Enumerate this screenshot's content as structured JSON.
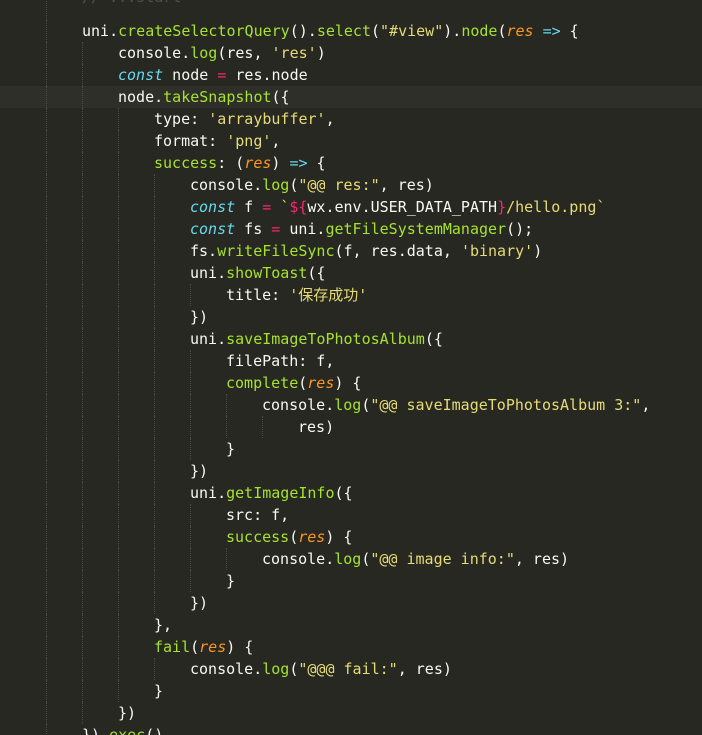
{
  "editor": {
    "colors": {
      "background": "#272822",
      "current_line": "#2e2f29",
      "indent_guide": "#4a4b45",
      "plain": "#f8f8f2",
      "keyword": "#66d9ef",
      "function": "#a6e22e",
      "string": "#e6db74",
      "parameter": "#fd971f",
      "operator": "#f92672",
      "comment": "#75715e"
    },
    "current_line_index": 4,
    "lines": [
      {
        "indent": 2,
        "tokens": [
          [
            "c",
            "// ...start"
          ]
        ]
      },
      {
        "indent": 2,
        "tokens": [
          [
            "p",
            "uni."
          ],
          [
            "f",
            "createSelectorQuery"
          ],
          [
            "p",
            "()."
          ],
          [
            "f",
            "select"
          ],
          [
            "p",
            "("
          ],
          [
            "s",
            "\"#view\""
          ],
          [
            "p",
            ")."
          ],
          [
            "f",
            "node"
          ],
          [
            "p",
            "("
          ],
          [
            "a",
            "res"
          ],
          [
            "p",
            " "
          ],
          [
            "k",
            "=>"
          ],
          [
            "p",
            " {"
          ]
        ]
      },
      {
        "indent": 3,
        "tokens": [
          [
            "p",
            "console."
          ],
          [
            "f",
            "log"
          ],
          [
            "p",
            "(res, "
          ],
          [
            "s",
            "'res'"
          ],
          [
            "p",
            ")"
          ]
        ]
      },
      {
        "indent": 3,
        "tokens": [
          [
            "k",
            "const"
          ],
          [
            "p",
            " node "
          ],
          [
            "o",
            "="
          ],
          [
            "p",
            " res.node"
          ]
        ]
      },
      {
        "indent": 3,
        "tokens": [
          [
            "p",
            "node."
          ],
          [
            "f",
            "takeSnapshot"
          ],
          [
            "p",
            "({"
          ]
        ]
      },
      {
        "indent": 4,
        "tokens": [
          [
            "p",
            "type: "
          ],
          [
            "s",
            "'arraybuffer'"
          ],
          [
            "p",
            ","
          ]
        ]
      },
      {
        "indent": 4,
        "tokens": [
          [
            "p",
            "format: "
          ],
          [
            "s",
            "'png'"
          ],
          [
            "p",
            ","
          ]
        ]
      },
      {
        "indent": 4,
        "tokens": [
          [
            "f",
            "success"
          ],
          [
            "p",
            ": ("
          ],
          [
            "a",
            "res"
          ],
          [
            "p",
            ") "
          ],
          [
            "k",
            "=>"
          ],
          [
            "p",
            " {"
          ]
        ]
      },
      {
        "indent": 5,
        "tokens": [
          [
            "p",
            "console."
          ],
          [
            "f",
            "log"
          ],
          [
            "p",
            "("
          ],
          [
            "s",
            "\"@@ res:\""
          ],
          [
            "p",
            ", res)"
          ]
        ]
      },
      {
        "indent": 5,
        "tokens": [
          [
            "k",
            "const"
          ],
          [
            "p",
            " f "
          ],
          [
            "o",
            "="
          ],
          [
            "p",
            " "
          ],
          [
            "s",
            "`"
          ],
          [
            "o",
            "${"
          ],
          [
            "p",
            "wx.env.USER_DATA_PATH"
          ],
          [
            "o",
            "}"
          ],
          [
            "s",
            "/hello.png`"
          ]
        ]
      },
      {
        "indent": 5,
        "tokens": [
          [
            "k",
            "const"
          ],
          [
            "p",
            " fs "
          ],
          [
            "o",
            "="
          ],
          [
            "p",
            " uni."
          ],
          [
            "f",
            "getFileSystemManager"
          ],
          [
            "p",
            "();"
          ]
        ]
      },
      {
        "indent": 5,
        "tokens": [
          [
            "p",
            "fs."
          ],
          [
            "f",
            "writeFileSync"
          ],
          [
            "p",
            "(f, res.data, "
          ],
          [
            "s",
            "'binary'"
          ],
          [
            "p",
            ")"
          ]
        ]
      },
      {
        "indent": 5,
        "tokens": [
          [
            "p",
            "uni."
          ],
          [
            "f",
            "showToast"
          ],
          [
            "p",
            "({"
          ]
        ]
      },
      {
        "indent": 6,
        "tokens": [
          [
            "p",
            "title: "
          ],
          [
            "s",
            "'保存成功'"
          ]
        ]
      },
      {
        "indent": 5,
        "tokens": [
          [
            "p",
            "})"
          ]
        ]
      },
      {
        "indent": 5,
        "tokens": [
          [
            "p",
            "uni."
          ],
          [
            "f",
            "saveImageToPhotosAlbum"
          ],
          [
            "p",
            "({"
          ]
        ]
      },
      {
        "indent": 6,
        "tokens": [
          [
            "p",
            "filePath: f,"
          ]
        ]
      },
      {
        "indent": 6,
        "tokens": [
          [
            "f",
            "complete"
          ],
          [
            "p",
            "("
          ],
          [
            "a",
            "res"
          ],
          [
            "p",
            ") {"
          ]
        ]
      },
      {
        "indent": 7,
        "tokens": [
          [
            "p",
            "console."
          ],
          [
            "f",
            "log"
          ],
          [
            "p",
            "("
          ],
          [
            "s",
            "\"@@ saveImageToPhotosAlbum 3:\""
          ],
          [
            "p",
            ","
          ]
        ]
      },
      {
        "indent": 8,
        "tokens": [
          [
            "p",
            "res)"
          ]
        ]
      },
      {
        "indent": 6,
        "tokens": [
          [
            "p",
            "}"
          ]
        ]
      },
      {
        "indent": 5,
        "tokens": [
          [
            "p",
            "})"
          ]
        ]
      },
      {
        "indent": 5,
        "tokens": [
          [
            "p",
            "uni."
          ],
          [
            "f",
            "getImageInfo"
          ],
          [
            "p",
            "({"
          ]
        ]
      },
      {
        "indent": 6,
        "tokens": [
          [
            "p",
            "src: f,"
          ]
        ]
      },
      {
        "indent": 6,
        "tokens": [
          [
            "f",
            "success"
          ],
          [
            "p",
            "("
          ],
          [
            "a",
            "res"
          ],
          [
            "p",
            ") {"
          ]
        ]
      },
      {
        "indent": 7,
        "tokens": [
          [
            "p",
            "console."
          ],
          [
            "f",
            "log"
          ],
          [
            "p",
            "("
          ],
          [
            "s",
            "\"@@ image info:\""
          ],
          [
            "p",
            ", res)"
          ]
        ]
      },
      {
        "indent": 6,
        "tokens": [
          [
            "p",
            "}"
          ]
        ]
      },
      {
        "indent": 5,
        "tokens": [
          [
            "p",
            "})"
          ]
        ]
      },
      {
        "indent": 4,
        "tokens": [
          [
            "p",
            "},"
          ]
        ]
      },
      {
        "indent": 4,
        "tokens": [
          [
            "f",
            "fail"
          ],
          [
            "p",
            "("
          ],
          [
            "a",
            "res"
          ],
          [
            "p",
            ") {"
          ]
        ]
      },
      {
        "indent": 5,
        "tokens": [
          [
            "p",
            "console."
          ],
          [
            "f",
            "log"
          ],
          [
            "p",
            "("
          ],
          [
            "s",
            "\"@@@ fail:\""
          ],
          [
            "p",
            ", res)"
          ]
        ]
      },
      {
        "indent": 4,
        "tokens": [
          [
            "p",
            "}"
          ]
        ]
      },
      {
        "indent": 3,
        "tokens": [
          [
            "p",
            "})"
          ]
        ]
      },
      {
        "indent": 2,
        "tokens": [
          [
            "p",
            "})."
          ],
          [
            "f",
            "exec"
          ],
          [
            "p",
            "()"
          ]
        ]
      }
    ]
  }
}
